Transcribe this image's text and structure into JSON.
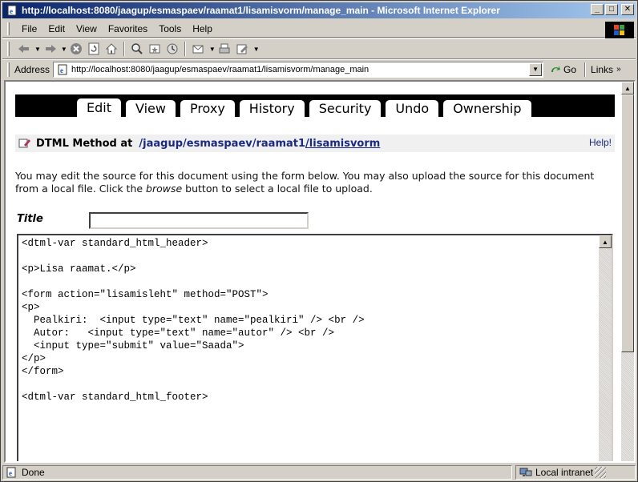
{
  "window": {
    "title": "http://localhost:8080/jaagup/esmaspaev/raamat1/lisamisvorm/manage_main - Microsoft Internet Explorer",
    "minimize": "_",
    "maximize": "□",
    "close": "✕"
  },
  "menu": {
    "file": "File",
    "edit": "Edit",
    "view": "View",
    "favorites": "Favorites",
    "tools": "Tools",
    "help": "Help"
  },
  "toolbar": {
    "icons": [
      "back-icon",
      "forward-icon",
      "stop-icon",
      "refresh-icon",
      "home-icon",
      "search-icon",
      "favorites-icon",
      "history-icon",
      "mail-icon",
      "print-icon",
      "edit-icon"
    ]
  },
  "address": {
    "label": "Address",
    "url": "http://localhost:8080/jaagup/esmaspaev/raamat1/lisamisvorm/manage_main",
    "go": "Go",
    "links": "Links"
  },
  "tabs": [
    {
      "label": "Edit",
      "active": true
    },
    {
      "label": "View",
      "active": false
    },
    {
      "label": "Proxy",
      "active": false
    },
    {
      "label": "History",
      "active": false
    },
    {
      "label": "Security",
      "active": false
    },
    {
      "label": "Undo",
      "active": false
    },
    {
      "label": "Ownership",
      "active": false
    }
  ],
  "object": {
    "type": "DTML Method at",
    "path": [
      "/jaagup",
      "/esmaspaev",
      "/raamat1",
      "/lisamisvorm"
    ],
    "help": "Help!"
  },
  "description": {
    "part1": "You may edit the source for this document using the form below. You may also upload the source for this document from a local file. Click the ",
    "emph": "browse",
    "part2": " button to select a local file to upload."
  },
  "form": {
    "title_label": "Title",
    "title_value": "",
    "source": "<dtml-var standard_html_header>\n\n<p>Lisa raamat.</p>\n\n<form action=\"lisamisleht\" method=\"POST\">\n<p>\n  Pealkiri:  <input type=\"text\" name=\"pealkiri\" /> <br />\n  Autor:   <input type=\"text\" name=\"autor\" /> <br />\n  <input type=\"submit\" value=\"Saada\">\n</p>\n</form>\n\n<dtml-var standard_html_footer>"
  },
  "status": {
    "text": "Done",
    "zone": "Local intranet"
  },
  "colors": {
    "titlebar_start": "#0a246a",
    "titlebar_end": "#a6caf0",
    "link": "#1b2a80",
    "chrome": "#d4d0c8"
  }
}
